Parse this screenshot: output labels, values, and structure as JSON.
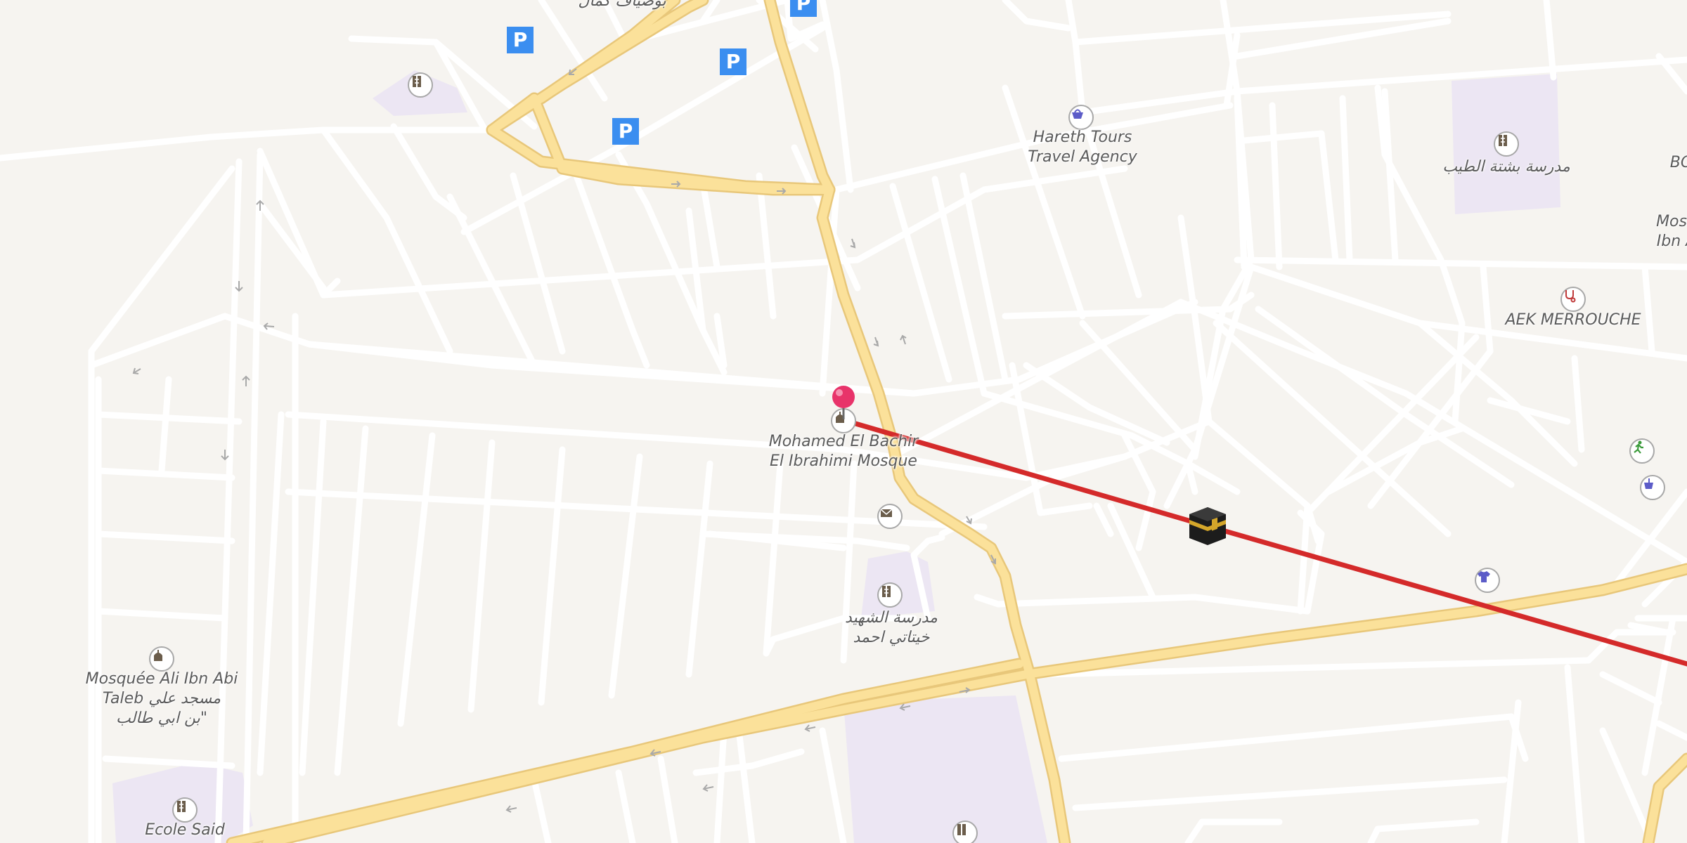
{
  "map": {
    "places": {
      "bachir_mosque": {
        "line1": "Mohamed El Bachir",
        "line2": "El Ibrahimi Mosque"
      },
      "hareth_tours": {
        "line1": "Hareth Tours",
        "line2": "Travel Agency"
      },
      "school_bachta": {
        "line1": "مدرسة بشتة الطيب"
      },
      "aek_merrouche": {
        "line1": "AEK MERROUCHE"
      },
      "school_chouhada": {
        "line1": "مدرسة الشهيد",
        "line2": "خيتاتي احمد"
      },
      "mosque_ali": {
        "line1": "Mosquée Ali Ibn Abi",
        "line2": "Taleb مسجد علي",
        "line3": "بن ابي طالب\""
      },
      "ecole_said": {
        "line1": "Ecole Said"
      },
      "top_cut_label": {
        "line1": "بوضياف كمال"
      },
      "right_cut_label1": {
        "line1": "BO"
      },
      "right_cut_label2": {
        "line1": "Mosq",
        "line2": "Ibn A"
      }
    },
    "parking_label": "P",
    "route_color": "#d42a2a",
    "road_major_color": "#fbe19a",
    "pin_color": "#e8336a",
    "icons": [
      "pin-icon",
      "mosque-icon",
      "kaaba-icon",
      "shopping-basket-icon",
      "school-icon",
      "mail-icon",
      "stethoscope-icon",
      "tshirt-icon",
      "running-icon",
      "cafe-icon",
      "parking-icon"
    ]
  }
}
